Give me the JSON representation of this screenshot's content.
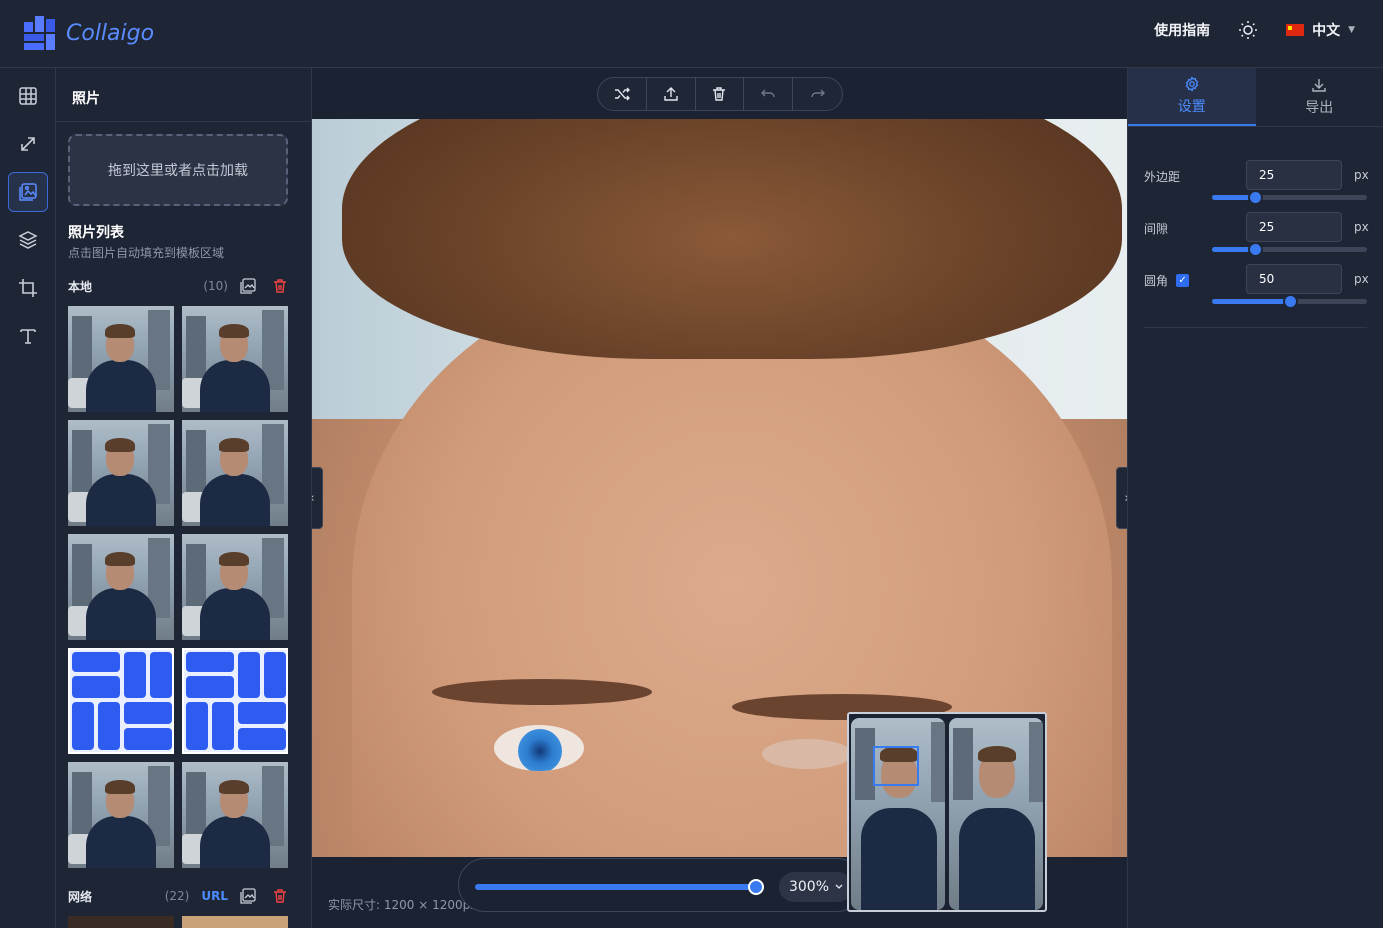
{
  "app": {
    "name": "Collaigo"
  },
  "header": {
    "guide_label": "使用指南",
    "language_label": "中文"
  },
  "rail": {
    "items": [
      "layout-grid-icon",
      "resize-icon",
      "photos-icon",
      "layers-icon",
      "crop-icon",
      "text-icon"
    ],
    "active": "photos-icon"
  },
  "sidebar": {
    "title": "照片",
    "dropzone_label": "拖到这里或者点击加载",
    "list_title": "照片列表",
    "list_subtitle": "点击图片自动填充到模板区域",
    "local": {
      "name": "本地",
      "count": "(10)"
    },
    "network": {
      "name": "网络",
      "count": "(22)",
      "url_label": "URL"
    }
  },
  "canvas": {
    "toolbar": [
      "shuffle-icon",
      "upload-icon",
      "trash-icon",
      "undo-icon",
      "redo-icon"
    ],
    "zoom_label": "300%",
    "zoom_fraction": 0.97,
    "actual_size": "实际尺寸: 1200 × 1200px"
  },
  "right_panel": {
    "tabs": [
      {
        "label": "设置",
        "icon": "gear-icon",
        "active": true
      },
      {
        "label": "导出",
        "icon": "download-icon",
        "active": false
      }
    ],
    "settings": [
      {
        "label": "外边距",
        "value": "25",
        "unit": "px",
        "fraction": 0.28
      },
      {
        "label": "间隙",
        "value": "25",
        "unit": "px",
        "fraction": 0.28
      },
      {
        "label": "圆角",
        "value": "50",
        "unit": "px",
        "fraction": 0.5,
        "checked": true
      }
    ]
  },
  "colors": {
    "accent": "#3a7af0",
    "background": "#1e2534"
  }
}
